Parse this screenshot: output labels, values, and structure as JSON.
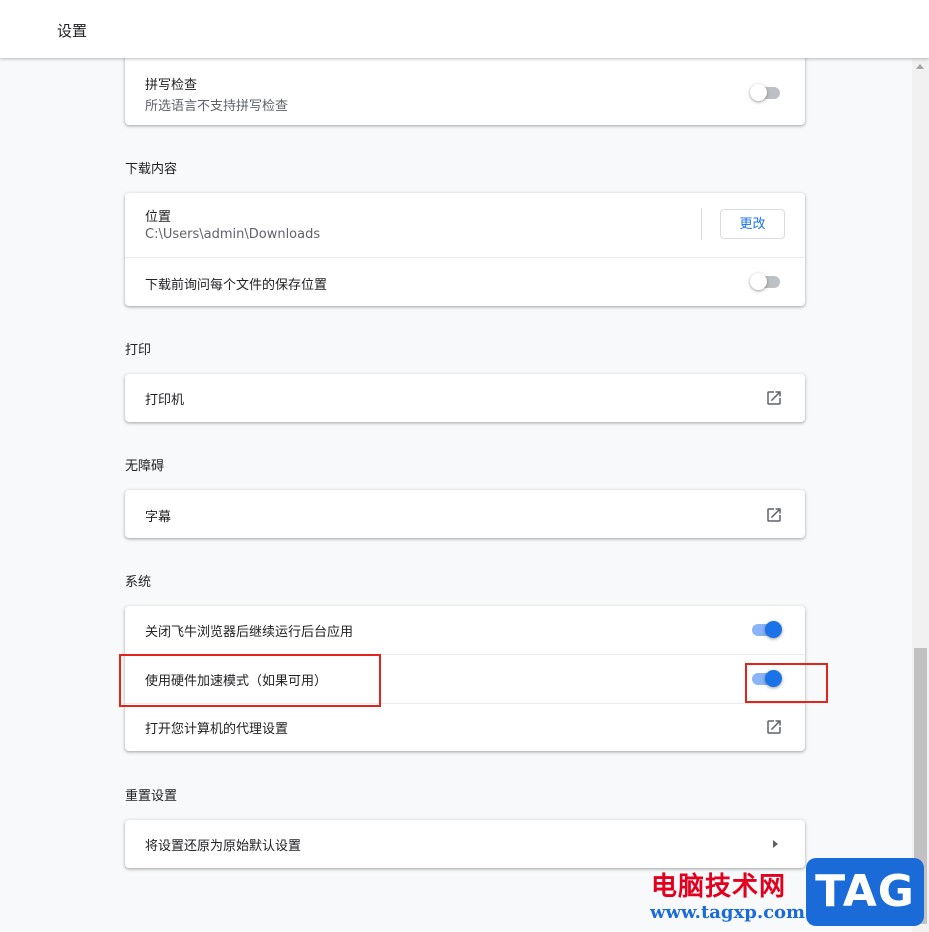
{
  "header": {
    "title": "设置"
  },
  "spellcheck": {
    "label": "拼写检查",
    "sub": "所选语言不支持拼写检查",
    "enabled": false
  },
  "downloads": {
    "title": "下载内容",
    "location_label": "位置",
    "location_value": "C:\\Users\\admin\\Downloads",
    "change_button": "更改",
    "ask_label": "下载前询问每个文件的保存位置",
    "ask_enabled": false
  },
  "printing": {
    "title": "打印",
    "printers_label": "打印机"
  },
  "accessibility": {
    "title": "无障碍",
    "captions_label": "字幕"
  },
  "system": {
    "title": "系统",
    "background_label": "关闭飞牛浏览器后继续运行后台应用",
    "background_enabled": true,
    "hw_accel_label": "使用硬件加速模式（如果可用）",
    "hw_accel_enabled": true,
    "proxy_label": "打开您计算机的代理设置"
  },
  "reset": {
    "title": "重置设置",
    "restore_label": "将设置还原为原始默认设置"
  },
  "watermark": {
    "brand": "电脑技术网",
    "url": "www.tagxp.com",
    "tag": "TAG"
  },
  "colors": {
    "accent": "#1a73e8",
    "highlight": "#e1251b"
  },
  "icons": {
    "external": "open-in-new-icon",
    "caret": "chevron-right-icon"
  }
}
